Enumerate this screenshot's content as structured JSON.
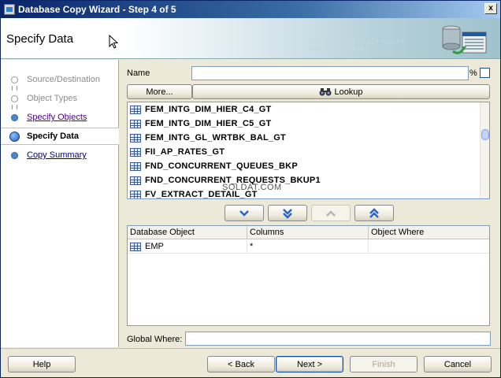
{
  "window": {
    "title": "Database Copy Wizard - Step 4 of 5",
    "close_glyph": "x"
  },
  "banner": {
    "title": "Specify Data",
    "binary_text": "01010101010101010101010101\n010101010101010"
  },
  "nav": {
    "items": [
      {
        "label": "Source/Destination",
        "state": "done"
      },
      {
        "label": "Object Types",
        "state": "done"
      },
      {
        "label": "Specify Objects",
        "state": "link"
      },
      {
        "label": "Specify Data",
        "state": "current"
      },
      {
        "label": "Copy Summary",
        "state": "link"
      }
    ]
  },
  "filter": {
    "name_label": "Name",
    "name_value": "",
    "percent_label": "%",
    "more_label": "More...",
    "lookup_label": "Lookup"
  },
  "objects": [
    "FEM_INTG_DIM_HIER_C4_GT",
    "FEM_INTG_DIM_HIER_C5_GT",
    "FEM_INTG_GL_WRTBK_BAL_GT",
    "FII_AP_RATES_GT",
    "FND_CONCURRENT_QUEUES_BKP",
    "FND_CONCURRENT_REQUESTS_BKUP1",
    "FV_EXTRACT_DETAIL_GT"
  ],
  "watermark": "SOLDAT.COM",
  "selected_grid": {
    "columns": [
      "Database Object",
      "Columns",
      "Object Where"
    ],
    "rows": [
      {
        "object": "EMP",
        "columns": "*",
        "where": ""
      }
    ]
  },
  "global_where": {
    "label": "Global Where:",
    "value": ""
  },
  "footer": {
    "help": "Help",
    "back": "< Back",
    "next": "Next >",
    "finish": "Finish",
    "cancel": "Cancel"
  }
}
